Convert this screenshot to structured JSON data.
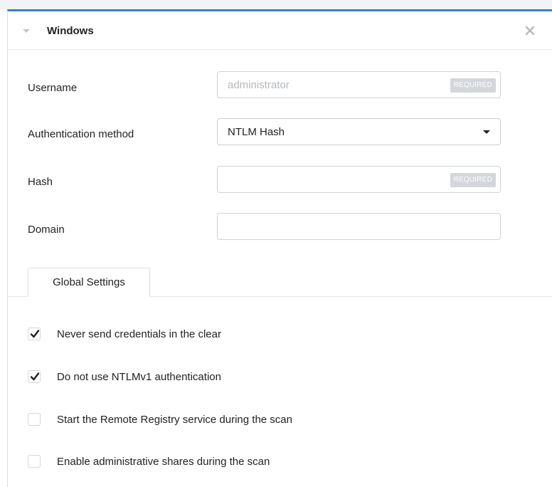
{
  "panel": {
    "title": "Windows",
    "accent_color": "#3a7fc1",
    "collapse_icon": "caret-down-icon",
    "close_icon": "close-icon"
  },
  "form": {
    "username": {
      "label": "Username",
      "value": "",
      "placeholder": "administrator",
      "badge": "REQUIRED"
    },
    "auth_method": {
      "label": "Authentication method",
      "selected": "NTLM Hash"
    },
    "hash": {
      "label": "Hash",
      "value": "",
      "badge": "REQUIRED"
    },
    "domain": {
      "label": "Domain",
      "value": ""
    }
  },
  "tabs": [
    {
      "label": "Global Settings",
      "active": true
    }
  ],
  "settings": [
    {
      "label": "Never send credentials in the clear",
      "checked": true
    },
    {
      "label": "Do not use NTLMv1 authentication",
      "checked": true
    },
    {
      "label": "Start the Remote Registry service during the scan",
      "checked": false
    },
    {
      "label": "Enable administrative shares during the scan",
      "checked": false
    }
  ]
}
